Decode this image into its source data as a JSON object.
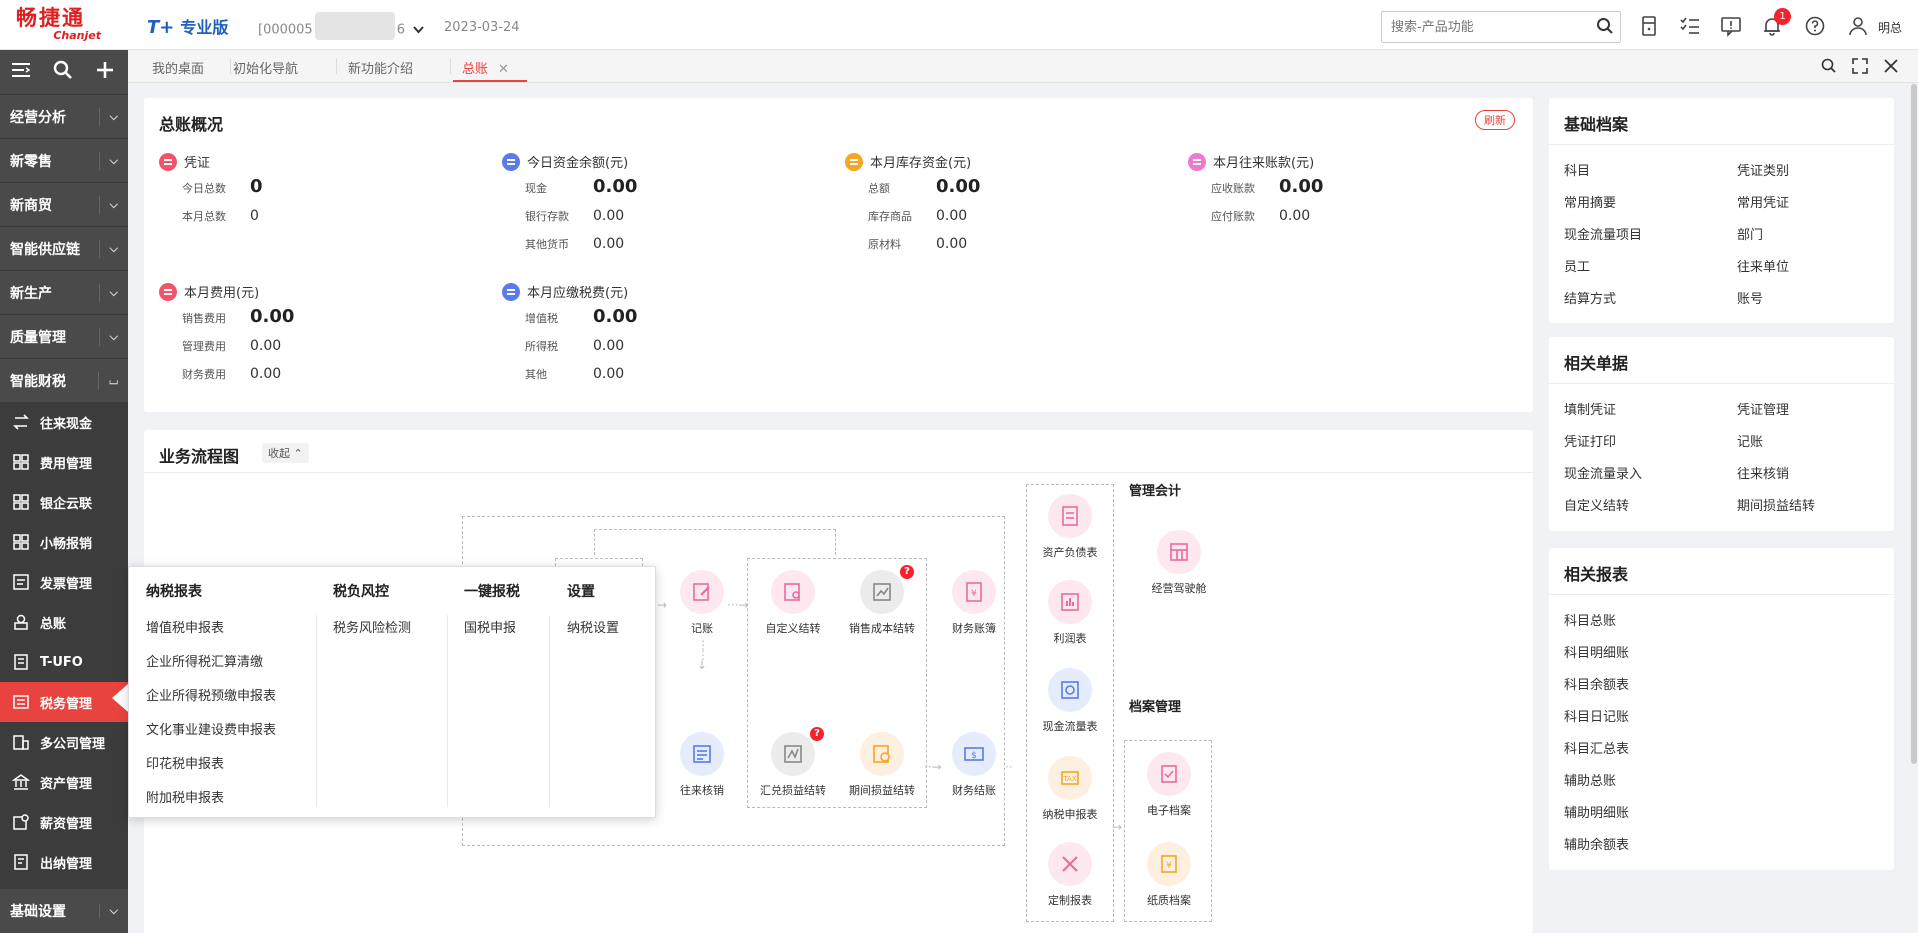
{
  "header": {
    "logo_cn": "畅捷通",
    "logo_en": "Chanjet",
    "edition_tplus": "T+",
    "edition_label": "专业版",
    "account_prefix": "[000005",
    "account_suffix": "6",
    "date": "2023-03-24",
    "search_placeholder": "搜索-产品功能",
    "notification_count": "1",
    "user_name": "明总"
  },
  "sidebar": {
    "groups_top": [
      {
        "label": "经营分析"
      },
      {
        "label": "新零售"
      },
      {
        "label": "新商贸"
      },
      {
        "label": "智能供应链"
      },
      {
        "label": "新生产"
      },
      {
        "label": "质量管理"
      },
      {
        "label": "智能财税"
      }
    ],
    "sub_items": [
      {
        "label": "往来现金",
        "icon": "transfer-icon"
      },
      {
        "label": "费用管理",
        "icon": "grid-icon"
      },
      {
        "label": "银企云联",
        "icon": "grid-icon"
      },
      {
        "label": "小畅报销",
        "icon": "grid-icon"
      },
      {
        "label": "发票管理",
        "icon": "invoice-icon"
      },
      {
        "label": "总账",
        "icon": "ledger-icon"
      },
      {
        "label": "T-UFO",
        "icon": "report-icon"
      },
      {
        "label": "税务管理",
        "icon": "tax-icon"
      },
      {
        "label": "多公司管理",
        "icon": "building-icon"
      },
      {
        "label": "资产管理",
        "icon": "bank-icon"
      },
      {
        "label": "薪资管理",
        "icon": "salary-icon"
      },
      {
        "label": "出纳管理",
        "icon": "cashier-icon"
      }
    ],
    "bottom": "基础设置"
  },
  "tabs": [
    {
      "label": "我的桌面"
    },
    {
      "label": "初始化导航"
    },
    {
      "label": "新功能介绍"
    },
    {
      "label": "总账"
    }
  ],
  "overview": {
    "title": "总账概况",
    "refresh": "刷新",
    "metrics": [
      {
        "title": "凭证",
        "color": "#f2556b",
        "rows": [
          {
            "label": "今日总数",
            "value": "0"
          },
          {
            "label": "本月总数",
            "value": "0"
          }
        ]
      },
      {
        "title": "今日资金余额(元)",
        "color": "#5b7be8",
        "rows": [
          {
            "label": "现金",
            "value": "0.00"
          },
          {
            "label": "银行存款",
            "value": "0.00"
          },
          {
            "label": "其他货币",
            "value": "0.00"
          }
        ]
      },
      {
        "title": "本月库存资金(元)",
        "color": "#f5a623",
        "rows": [
          {
            "label": "总额",
            "value": "0.00"
          },
          {
            "label": "库存商品",
            "value": "0.00"
          },
          {
            "label": "原材料",
            "value": "0.00"
          }
        ]
      },
      {
        "title": "本月往来账款(元)",
        "color": "#ee7ad0",
        "rows": [
          {
            "label": "应收账款",
            "value": "0.00"
          },
          {
            "label": "应付账款",
            "value": "0.00"
          }
        ]
      },
      {
        "title": "本月费用(元)",
        "color": "#f2556b",
        "rows": [
          {
            "label": "销售费用",
            "value": "0.00"
          },
          {
            "label": "管理费用",
            "value": "0.00"
          },
          {
            "label": "财务费用",
            "value": "0.00"
          }
        ]
      },
      {
        "title": "本月应缴税费(元)",
        "color": "#5b7be8",
        "rows": [
          {
            "label": "增值税",
            "value": "0.00"
          },
          {
            "label": "所得税",
            "value": "0.00"
          },
          {
            "label": "其他",
            "value": "0.00"
          }
        ]
      }
    ]
  },
  "basic_archives": {
    "title": "基础档案",
    "items": [
      "科目",
      "凭证类别",
      "常用摘要",
      "常用凭证",
      "现金流量项目",
      "部门",
      "员工",
      "往来单位",
      "结算方式",
      "账号"
    ]
  },
  "related_docs": {
    "title": "相关单据",
    "items": [
      "填制凭证",
      "凭证管理",
      "凭证打印",
      "记账",
      "现金流量录入",
      "往来核销",
      "自定义结转",
      "期间损益结转"
    ]
  },
  "related_reports": {
    "title": "相关报表",
    "items": [
      "科目总账",
      "科目明细账",
      "科目余额表",
      "科目日记账",
      "科目汇总表",
      "辅助总账",
      "辅助明细账",
      "辅助余额表"
    ]
  },
  "flow": {
    "title": "业务流程图",
    "collapse": "收起",
    "section_mgmt": "管理会计",
    "section_archive": "档案管理",
    "nodes": {
      "jizhang": "记账",
      "zdyjz": "自定义结转",
      "xscbjz": "销售成本结转",
      "cwzb": "财务账簿",
      "wlhx": "往来核销",
      "hdsyjz": "汇兑损益结转",
      "qjsyjz": "期间损益结转",
      "cwjz": "财务结账",
      "zcfzb": "资产负债表",
      "lrb": "利润表",
      "xjllb": "现金流量表",
      "nssbb": "纳税申报表",
      "dzbb": "定制报表",
      "jyjsc": "经营驾驶舱",
      "dzda": "电子档案",
      "zzda": "纸质档案"
    }
  },
  "tax_popup": {
    "col1_title": "纳税报表",
    "col1_items": [
      "增值税申报表",
      "企业所得税汇算清缴",
      "企业所得税预缴申报表",
      "文化事业建设费申报表",
      "印花税申报表",
      "附加税申报表"
    ],
    "col2_title": "税负风控",
    "col2_items": [
      "税务风险检测"
    ],
    "col3_title": "一键报税",
    "col3_items": [
      "国税申报"
    ],
    "col4_title": "设置",
    "col4_items": [
      "纳税设置"
    ]
  }
}
